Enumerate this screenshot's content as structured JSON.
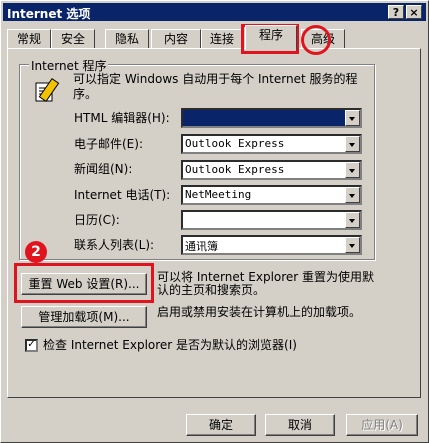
{
  "window": {
    "title": "Internet 选项"
  },
  "title_buttons": {
    "help": "?",
    "close": "×"
  },
  "tabs": [
    {
      "label": "常规"
    },
    {
      "label": "安全"
    },
    {
      "label": "隐私"
    },
    {
      "label": "内容"
    },
    {
      "label": "连接"
    },
    {
      "label": "程序"
    },
    {
      "label": "高级"
    }
  ],
  "group": {
    "title": "Internet 程序",
    "description": "可以指定 Windows 自动用于每个 Internet 服务的程序。",
    "rows": [
      {
        "label": "HTML 编辑器(H):",
        "value": ""
      },
      {
        "label": "电子邮件(E):",
        "value": "Outlook Express"
      },
      {
        "label": "新闻组(N):",
        "value": "Outlook Express"
      },
      {
        "label": "Internet 电话(T):",
        "value": "NetMeeting"
      },
      {
        "label": "日历(C):",
        "value": ""
      },
      {
        "label": "联系人列表(L):",
        "value": "通讯簿"
      }
    ]
  },
  "reset": {
    "button": "重置 Web 设置(R)...",
    "note_line1": "可以将 Internet Explorer 重置为使用默",
    "note_line2": "认的主页和搜索页。"
  },
  "addons": {
    "button": "管理加载项(M)...",
    "note": "启用或禁用安装在计算机上的加载项。"
  },
  "check_default": {
    "label": "检查 Internet Explorer 是否为默认的浏览器(I)",
    "checked": true
  },
  "footer": {
    "ok": "确定",
    "cancel": "取消",
    "apply": "应用(A)"
  },
  "annotations": {
    "marker2": "2"
  },
  "colors": {
    "highlight": "#e0141e",
    "titlebar": "#0a246a",
    "dialog": "#d4d0c8"
  }
}
